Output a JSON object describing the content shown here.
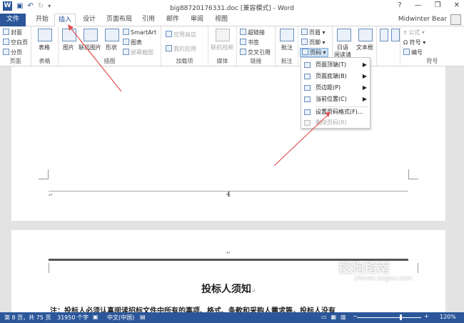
{
  "titlebar": {
    "app_icon": "W",
    "title": "big88720176331.doc [兼容模式] - Word",
    "help": "?",
    "minimize": "—",
    "restore": "❐",
    "close": "✕"
  },
  "tabs": [
    {
      "label": "文件"
    },
    {
      "label": "开始"
    },
    {
      "label": "插入"
    },
    {
      "label": "设计"
    },
    {
      "label": "页面布局"
    },
    {
      "label": "引用"
    },
    {
      "label": "邮件"
    },
    {
      "label": "审阅"
    },
    {
      "label": "视图"
    }
  ],
  "user": "Midwinter Bear",
  "ribbon": {
    "pages": {
      "label": "页面",
      "cover": "封面",
      "blank": "空白页",
      "break": "分页"
    },
    "tables": {
      "label": "表格",
      "table": "表格"
    },
    "illustrations": {
      "label": "插图",
      "picture": "图片",
      "online_picture": "联机图片",
      "shapes": "形状",
      "smartart": "SmartArt",
      "chart": "图表",
      "screenshot": "屏幕截图"
    },
    "addins": {
      "label": "加载项",
      "store": "应用商店",
      "my_apps": "我的应用"
    },
    "media": {
      "label": "媒体",
      "online_video": "联机视频"
    },
    "links": {
      "label": "链接",
      "hyperlink": "超链接",
      "bookmark": "书签",
      "cross_ref": "交叉引用"
    },
    "comments": {
      "label": "批注",
      "comment": "批注"
    },
    "header_footer": {
      "header": "页眉",
      "footer": "页脚",
      "page_number": "页码"
    },
    "text": {
      "label": "本",
      "date": "日语",
      "reading": "阅读请",
      "textbox": "文本框"
    },
    "symbols": {
      "label": "符号",
      "equation": "公式",
      "symbol": "符号",
      "number": "编号"
    }
  },
  "menu": {
    "items": [
      {
        "label": "页面顶端(T)",
        "arrow": "▶"
      },
      {
        "label": "页面底端(B)",
        "arrow": "▶"
      },
      {
        "label": "页边距(P)",
        "arrow": "▶"
      },
      {
        "label": "当前位置(C)",
        "arrow": "▶"
      },
      {
        "label": "设置页码格式(F)..."
      },
      {
        "label": "删除页码(R)"
      }
    ]
  },
  "document": {
    "page_number": "4",
    "para_mark": "↵",
    "heading": "投标人须知",
    "body_line": "注：投标人必须认真阅读招标文件中所有的事项、格式、条款和采购人需求等，投标人没有"
  },
  "watermark": {
    "text": "搜狗指南",
    "url": "zhinan.sogou.com"
  },
  "status": {
    "page": "第 8 页，共 75 页",
    "words": "31950 个字",
    "lang": "中文(中国)",
    "zoom": "120%"
  },
  "colors": {
    "accent": "#2b579a",
    "annotation": "#e05050"
  }
}
